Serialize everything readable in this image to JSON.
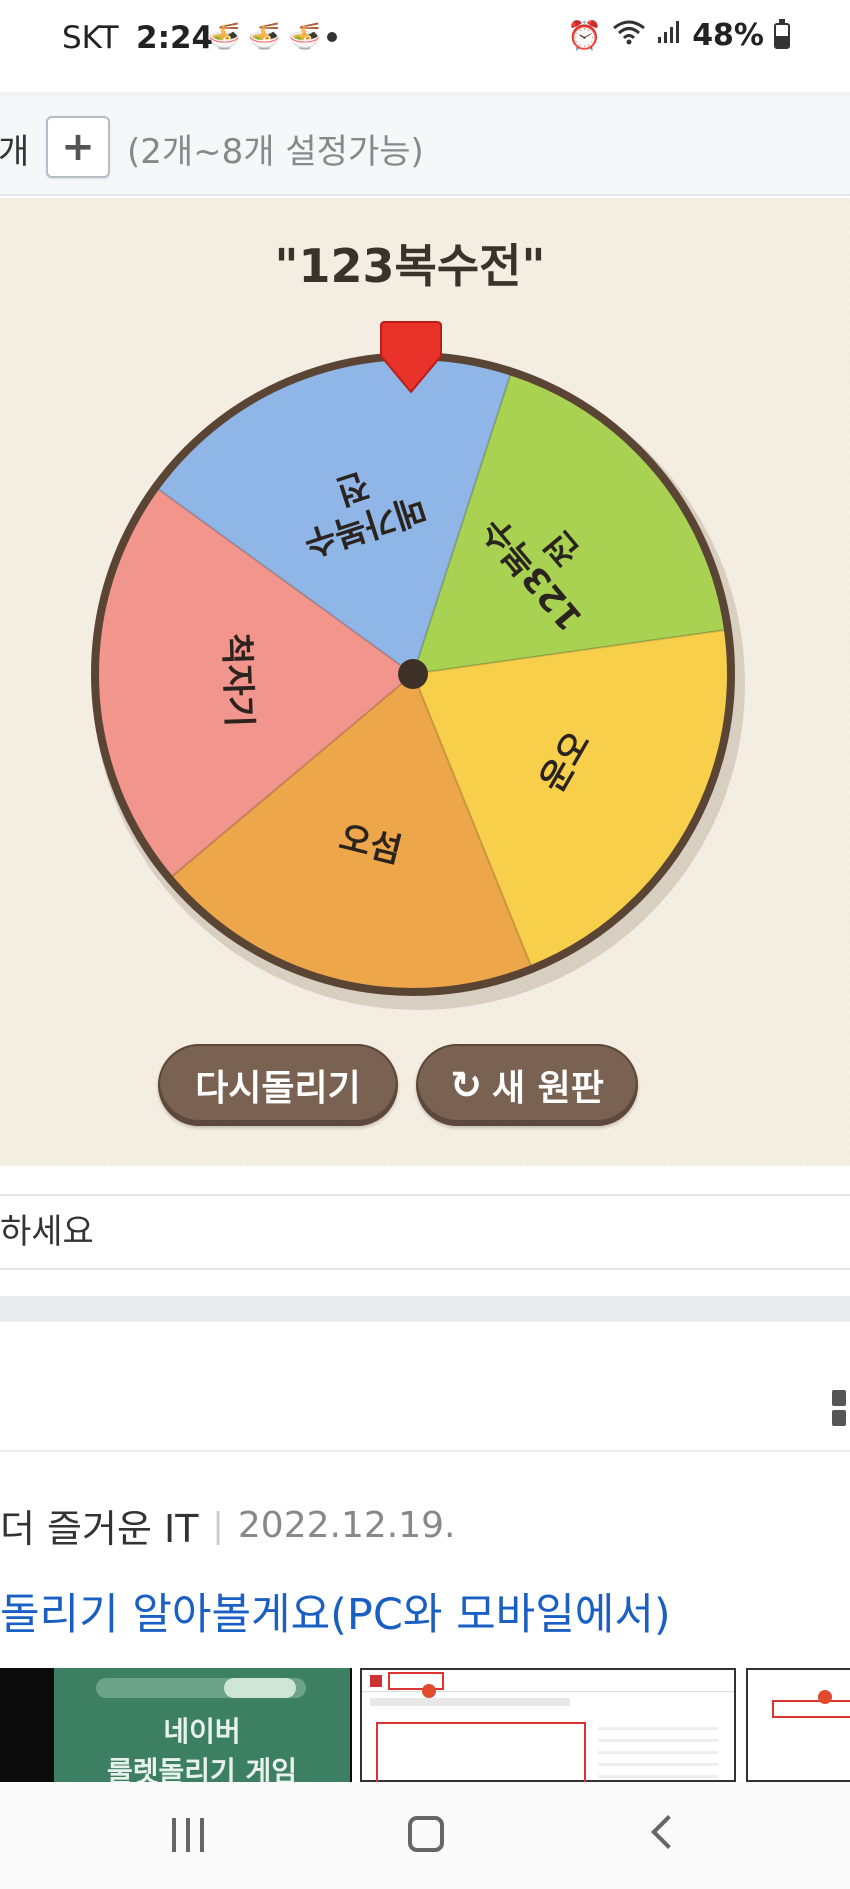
{
  "status_bar": {
    "carrier": "SKT",
    "time": "2:24",
    "notification_icons": [
      "noodle-icon",
      "noodle-icon",
      "noodle-icon"
    ],
    "battery": "48%",
    "battery_level": 0.48,
    "icons": [
      "alarm-icon",
      "wifi-icon",
      "signal-icon",
      "battery-icon"
    ]
  },
  "count_bar": {
    "cut_label": "개",
    "plus_label": "+",
    "hint": "(2개~8개 설정가능)"
  },
  "roulette": {
    "result_title": "\"123복수전\"",
    "slices": [
      {
        "label_lines": [
          "123복수",
          "전"
        ],
        "color": "#a9d253"
      },
      {
        "label_lines": [
          "운오"
        ],
        "color": "#f7cf4a"
      },
      {
        "label_lines": [
          "오섬"
        ],
        "color": "#eda64a"
      },
      {
        "label_lines": [
          "척자기"
        ],
        "color": "#f2958d"
      },
      {
        "label_lines": [
          "메가복수",
          "전"
        ],
        "color": "#8fb6e6"
      }
    ],
    "rim_color": "#5a4434",
    "pointer_color": "#e8322a",
    "respin_label": "다시돌리기",
    "new_label": "새 원판",
    "new_icon": "refresh-icon"
  },
  "input": {
    "placeholder": "하세요"
  },
  "article": {
    "blog_name": "더 즐거운 IT",
    "date": "2022.12.19.",
    "title": "돌리기 알아볼게요(PC와 모바일에서)",
    "thumb1_line1": "네이버",
    "thumb1_line2": "룰렛돌리기 게임"
  },
  "nav_bar": {
    "icons": [
      "recents-icon",
      "home-icon",
      "back-icon"
    ]
  }
}
